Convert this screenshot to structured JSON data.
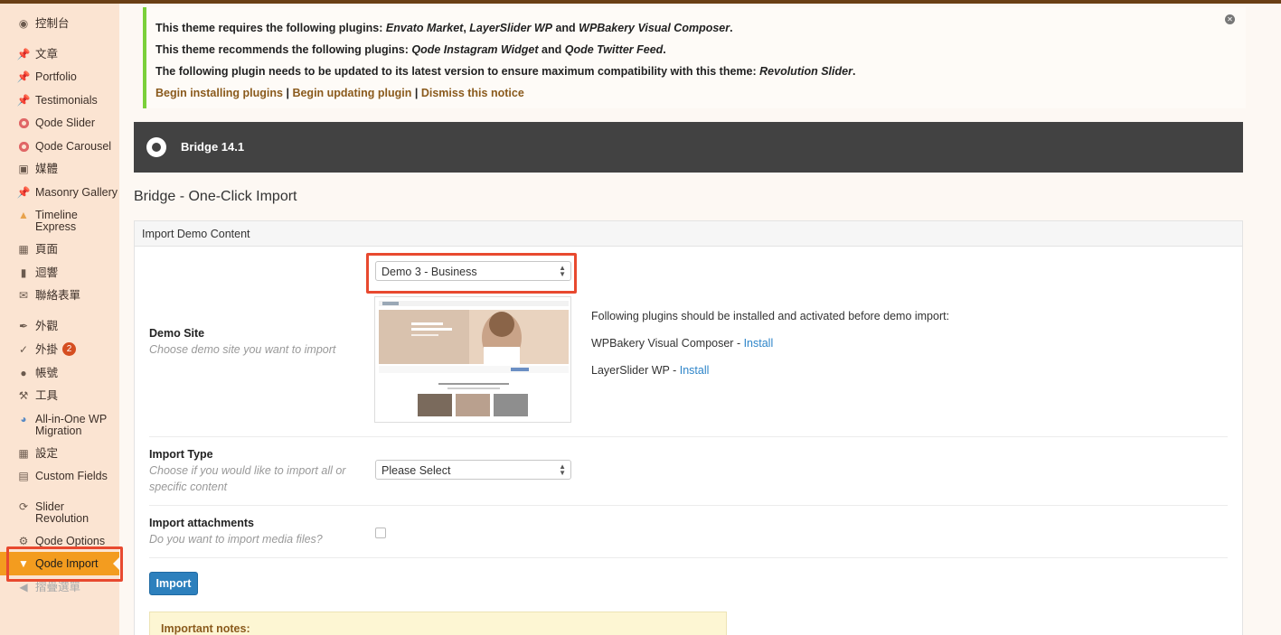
{
  "sidebar": {
    "items": [
      {
        "label": "控制台",
        "icon": "dashboard-icon"
      },
      {
        "label": "文章",
        "icon": "pin-icon"
      },
      {
        "label": "Portfolio",
        "icon": "pin-icon"
      },
      {
        "label": "Testimonials",
        "icon": "pin-icon"
      },
      {
        "label": "Qode Slider",
        "icon": "ring-icon"
      },
      {
        "label": "Qode Carousel",
        "icon": "ring-icon"
      },
      {
        "label": "媒體",
        "icon": "media-icon"
      },
      {
        "label": "Masonry Gallery",
        "icon": "pin-icon"
      },
      {
        "label": "Timeline Express",
        "icon": "timeline-icon"
      },
      {
        "label": "頁面",
        "icon": "page-icon"
      },
      {
        "label": "迴響",
        "icon": "comment-icon"
      },
      {
        "label": "聯絡表單",
        "icon": "mail-icon"
      },
      {
        "label": "外觀",
        "icon": "brush-icon"
      },
      {
        "label": "外掛",
        "icon": "plugin-icon",
        "badge": "2"
      },
      {
        "label": "帳號",
        "icon": "user-icon"
      },
      {
        "label": "工具",
        "icon": "wrench-icon"
      },
      {
        "label": "All-in-One WP Migration",
        "icon": "migration-icon"
      },
      {
        "label": "設定",
        "icon": "settings-icon"
      },
      {
        "label": "Custom Fields",
        "icon": "fields-icon"
      },
      {
        "label": "Slider Revolution",
        "icon": "refresh-icon"
      },
      {
        "label": "Qode Options",
        "icon": "gear-icon"
      },
      {
        "label": "Qode Import",
        "icon": "import-icon"
      },
      {
        "label": "摺疊選單",
        "icon": "collapse-icon"
      }
    ]
  },
  "notice": {
    "line1_prefix": "This theme requires the following plugins: ",
    "line1_p1": "Envato Market",
    "line1_sep1": ", ",
    "line1_p2": "LayerSlider WP",
    "line1_sep2": " and ",
    "line1_p3": "WPBakery Visual Composer",
    "line1_end": ".",
    "line2_prefix": "This theme recommends the following plugins: ",
    "line2_p1": "Qode Instagram Widget",
    "line2_sep": " and ",
    "line2_p2": "Qode Twitter Feed",
    "line2_end": ".",
    "line3_prefix": "The following plugin needs to be updated to its latest version to ensure maximum compatibility with this theme: ",
    "line3_p1": "Revolution Slider",
    "line3_end": ".",
    "link_install": "Begin installing plugins",
    "link_update": "Begin updating plugin",
    "link_dismiss": "Dismiss this notice",
    "separator": "|"
  },
  "header": {
    "title": "Bridge 14.1"
  },
  "page_title": "Bridge - One-Click Import",
  "panel": {
    "heading": "Import Demo Content",
    "demo_site": {
      "label": "Demo Site",
      "desc": "Choose demo site you want to import",
      "selected": "Demo 3 - Business"
    },
    "plugins_intro": "Following plugins should be installed and activated before demo import:",
    "plugins": [
      {
        "name": "WPBakery Visual Composer - ",
        "action": "Install"
      },
      {
        "name": "LayerSlider WP - ",
        "action": "Install"
      }
    ],
    "import_type": {
      "label": "Import Type",
      "desc": "Choose if you would like to import all or specific content",
      "selected": "Please Select"
    },
    "attachments": {
      "label": "Import attachments",
      "desc": "Do you want to import media files?"
    },
    "import_button": "Import",
    "notes_title": "Important notes:"
  },
  "colors": {
    "sidebar_bg": "#fbe4d2",
    "active_item": "#f39c1f",
    "highlight_box": "#e8492f",
    "link": "#2e85c9",
    "notice_link": "#8a5a1c",
    "header_bar": "#424242"
  }
}
